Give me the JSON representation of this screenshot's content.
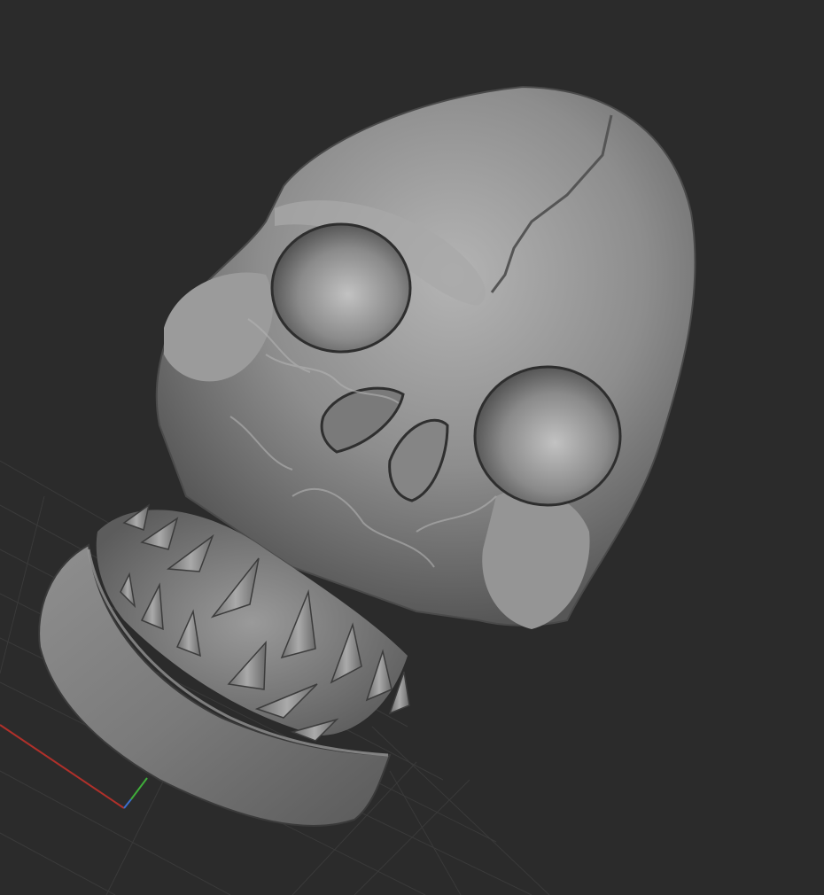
{
  "viewport": {
    "background": "#2b2b2b",
    "grid_visible": true,
    "grid_color": "#3a3a3a",
    "x_axis_color": "#b0302a",
    "y_axis_color": "#3fae3a",
    "z_axis_color": "#3a6fd0"
  },
  "model": {
    "type": "sculpted-skull-mesh",
    "shading": "matcap-gray",
    "base_color": "#7e7e7e",
    "highlight_color": "#bdbdbd",
    "shadow_color": "#3a3a3a",
    "features": [
      "cranium",
      "eye-socket-left",
      "eye-socket-right",
      "nasal-cavity",
      "upper-teeth",
      "lower-jaw"
    ]
  }
}
